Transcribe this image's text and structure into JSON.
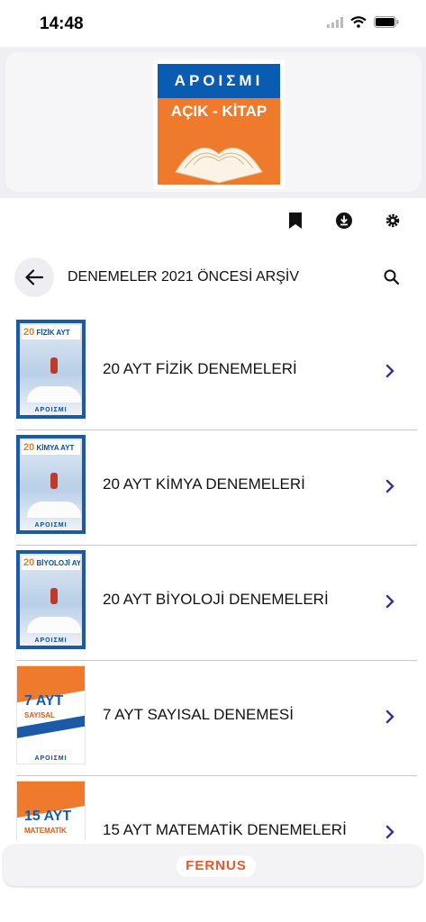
{
  "status_bar": {
    "time": "14:48"
  },
  "header": {
    "logo": {
      "brand_text": "APOIΣMI",
      "sub_text": "AÇIK - KİTAP"
    }
  },
  "toolbar": {
    "icons": [
      "bookmark-icon",
      "download-icon",
      "gear-icon"
    ]
  },
  "nav": {
    "title": "DENEMELER 2021 ÖNCESİ ARŞİV"
  },
  "items": [
    {
      "title": "20 AYT FİZİK DENEMELERİ",
      "cover_num": "20",
      "cover_subject": "FİZİK AYT",
      "cover_brand": "APOIΣMI"
    },
    {
      "title": "20  AYT  KİMYA  DENEMELERİ",
      "cover_num": "20",
      "cover_subject": "KİMYA AYT",
      "cover_brand": "APOIΣMI"
    },
    {
      "title": "20  AYT  BİYOLOJİ  DENEMELERİ",
      "cover_num": "20",
      "cover_subject": "BİYOLOJİ AYT",
      "cover_brand": "APOIΣMI"
    },
    {
      "title": "7 AYT SAYISAL DENEMESİ",
      "cover_num": "7 AYT",
      "cover_subject": "SAYISAL",
      "cover_brand": "APOIΣMI"
    },
    {
      "title": "15 AYT MATEMATİK DENEMELERİ",
      "cover_num": "15 AYT",
      "cover_subject": "MATEMATİK"
    }
  ],
  "footer": {
    "brand": "FERNUS"
  },
  "colors": {
    "accent": "#3a2f8f",
    "brand_orange": "#f07a2c",
    "brand_blue": "#0a5bb2"
  }
}
